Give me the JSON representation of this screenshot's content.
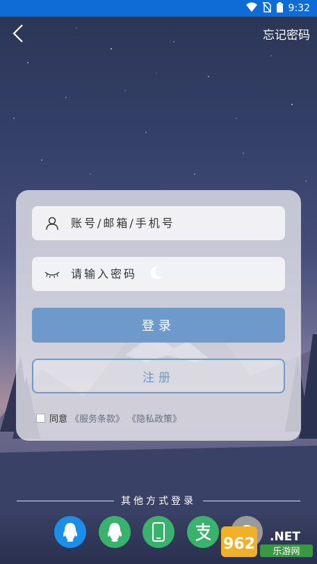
{
  "status_bar": {
    "time": "9:32"
  },
  "header": {
    "forgot_password": "忘记密码"
  },
  "login_form": {
    "account_placeholder": "账号/邮箱/手机号",
    "password_placeholder": "请输入密码",
    "login_button": "登录",
    "register_button": "注册",
    "agree_label": "同意",
    "terms_link": "《服务条款》",
    "privacy_link": "《隐私政策》"
  },
  "other_login": {
    "title": "其他方式登录",
    "methods": [
      {
        "icon": "qq-icon",
        "color": "#1a8fe8"
      },
      {
        "icon": "qq-icon",
        "color": "#39b26b"
      },
      {
        "icon": "phone-icon",
        "color": "#39b26b"
      },
      {
        "icon": "alipay-icon",
        "color": "#39b26b"
      },
      {
        "icon": "more-icon",
        "color": "#9a9a9a"
      }
    ]
  },
  "watermark": {
    "brand": "962",
    "suffix": ".NET",
    "site": "乐游网"
  },
  "colors": {
    "status_bar": "#0f6bd6",
    "accent": "#6d9acb"
  }
}
